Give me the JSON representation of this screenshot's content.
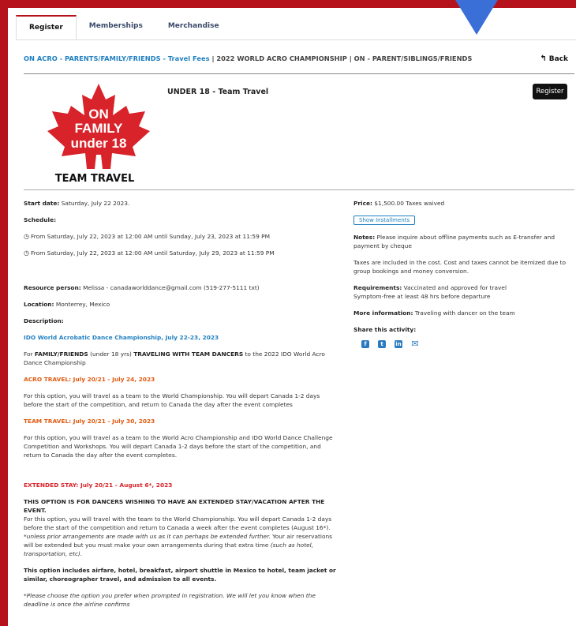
{
  "tabs": [
    "Register",
    "Memberships",
    "Merchandise"
  ],
  "breadcrumb": {
    "link": "ON ACRO - PARENTS/FAMILY/FRIENDS - Travel Fees",
    "sep1": "|",
    "item2": "2022 WORLD ACRO CHAMPIONSHIP",
    "sep2": "|",
    "item3": "ON - PARENT/SIBLINGS/FRIENDS"
  },
  "back_label": "Back",
  "activity_title": "UNDER 18 - Team Travel",
  "register_label": "Register",
  "logo": {
    "line1": "ON",
    "line2": "FAMILY",
    "line3": "under 18",
    "line4": "TEAM TRAVEL"
  },
  "details": {
    "start_label": "Start date:",
    "start_value": "Saturday, July 22 2023.",
    "schedule_label": "Schedule:",
    "schedule1": "From Saturday, July 22, 2023 at 12:00 AM until Sunday, July 23, 2023 at 11:59 PM",
    "schedule2": "From Saturday, July 22, 2023 at 12:00 AM until Saturday, July 29, 2023 at 11:59 PM",
    "resource_label": "Resource person:",
    "resource_value": "Melissa - canadaworlddance@gmail.com (519-277-5111 txt)",
    "location_label": "Location:",
    "location_value": "Monterrey, Mexico",
    "description_label": "Description:"
  },
  "description": {
    "heading": "IDO World Acrobatic Dance Championship, July 22-23, 2023",
    "intro_pre": "For ",
    "intro_bold1": "FAMILY/FRIENDS",
    "intro_mid": " (under 18 yrs) ",
    "intro_bold2": "TRAVELING WITH TEAM DANCERS",
    "intro_post": " to the 2022 IDO World Acro Dance Championship",
    "acro_heading": "ACRO TRAVEL:  July 20/21 - July 24, 2023",
    "acro_text": "For this option, you will travel as a team to the World Championship.  You will depart Canada 1-2 days before the start of the competition, and return to Canada the day after the event completes",
    "team_heading": "TEAM TRAVEL:  July 20/21 - July 30, 2023",
    "team_text": "For this option, you will travel as a team to the World Acro Championship and IDO World Dance Challenge Competition and Workshops.  You will depart Canada 1-2 days before the start of the competition, and return to Canada the day after the event completes.",
    "ext_heading": "EXTENDED STAY:  July 20/21 - August 6*, 2023",
    "ext_bold": "THIS OPTION IS FOR DANCERS WISHING TO HAVE AN EXTENDED STAY/VACATION AFTER THE EVENT.",
    "ext_text": "For this option, you will travel with the team to the World Championship.  You will depart Canada 1-2 days before the start of the competition and return to Canada a week after the event completes (August 16*).",
    "ext_italic": " *unless prior arrangements are made with us as it can perhaps be extended further.",
    "ext_text2": "  Your air reservations will be extended but you must make your own arrangements during that extra time ",
    "ext_italic2": "(such as hotel, transportation, etc).",
    "includes": "This option includes airfare, hotel, breakfast, airport shuttle in Mexico to hotel, team jacket or similar, choreographer travel, and admission to all events.",
    "footnote": "*Please choose the option you prefer when prompted in registration.  We will let you know when the deadline is once the airline confirms"
  },
  "side": {
    "price_label": "Price:",
    "price_value": "$1,500.00 Taxes waived",
    "installments_label": "Show Installments",
    "notes_label": "Notes:",
    "notes_value": "Please inquire about offline payments such as E-transfer and payment by cheque",
    "taxes_text": "Taxes are included in the cost. Cost and taxes cannot be itemized due to group bookings and money conversion.",
    "requirements_label": "Requirements:",
    "requirements_value1": "Vaccinated and approved for travel",
    "requirements_value2": "Symptom-free at least 48 hrs before departure",
    "more_label": "More information:",
    "more_value": "Traveling with dancer on the team",
    "share_label": "Share this activity:"
  },
  "colors": {
    "brand_red": "#b5121b",
    "link_blue": "#1f7fc0",
    "orange": "#e05a10"
  },
  "icons": [
    "facebook-icon",
    "twitter-icon",
    "linkedin-icon",
    "mail-icon",
    "back-arrow-icon",
    "clock-icon"
  ]
}
